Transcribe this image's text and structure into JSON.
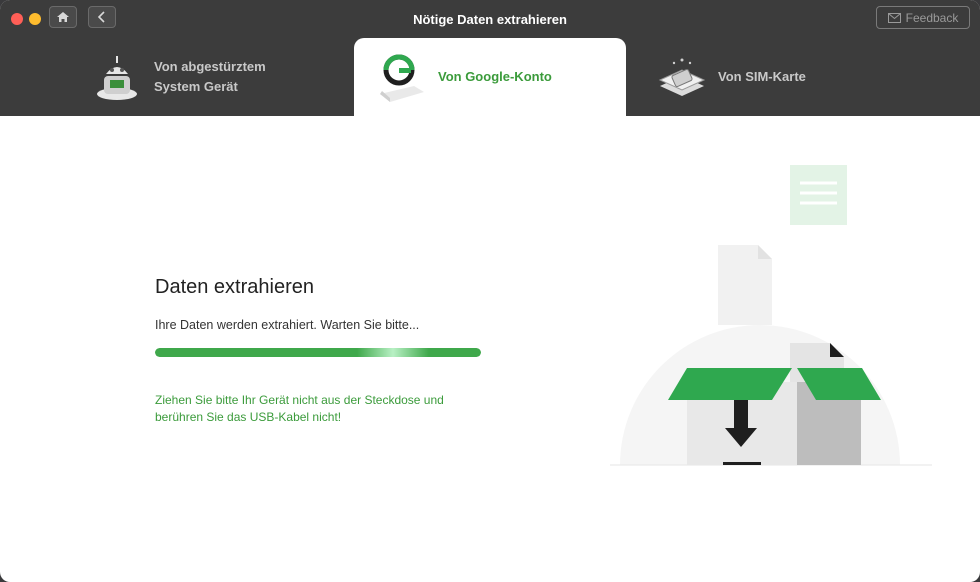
{
  "window": {
    "title": "Nötige Daten extrahieren"
  },
  "toolbar": {
    "feedback_label": "Feedback"
  },
  "tabs": [
    {
      "label_line1": "Von abgestürztem",
      "label_line2": "System Gerät",
      "active": false
    },
    {
      "label": "Von Google-Konto",
      "active": true
    },
    {
      "label": "Von SIM-Karte",
      "active": false
    }
  ],
  "main": {
    "heading": "Daten extrahieren",
    "status": "Ihre Daten werden extrahiert. Warten Sie bitte...",
    "progress": 1.0,
    "warning": "Ziehen Sie bitte Ihr Gerät nicht aus der Steckdose und berühren Sie das USB-Kabel nicht!"
  },
  "colors": {
    "accent": "#3b9b3b",
    "topbar": "#3c3c3c"
  },
  "icons": {
    "home": "home-icon",
    "back": "chevron-left-icon",
    "feedback": "mail-icon",
    "tab1": "broken-robot-icon",
    "tab2": "google-g-icon",
    "tab3": "sim-card-icon"
  }
}
